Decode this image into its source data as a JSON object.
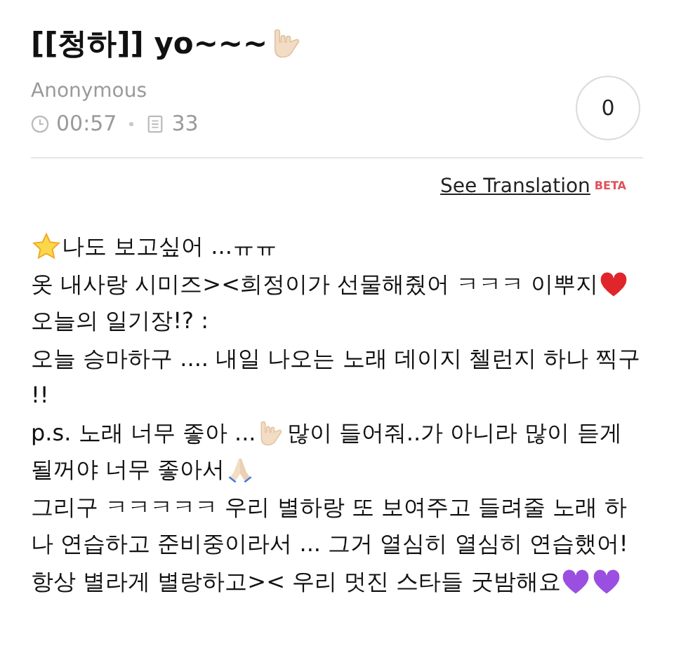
{
  "post": {
    "title": [
      {
        "kind": "text",
        "text": "[[청하]] yo~~~"
      },
      {
        "kind": "rock-hand"
      }
    ],
    "author": "Anonymous",
    "time": "00:57",
    "views": "33",
    "like_count": "0"
  },
  "translation": {
    "link": "See Translation",
    "badge": "BETA"
  },
  "body_lines": [
    [
      {
        "kind": "star"
      },
      {
        "kind": "text",
        "text": " 나도 보고싶어 ...ㅠㅠ"
      }
    ],
    [
      {
        "kind": "text",
        "text": "옷 내사랑 시미즈><희정이가 선물해줬어 ㅋㅋㅋ 이뿌지"
      },
      {
        "kind": "heart"
      }
    ],
    [
      {
        "kind": "text",
        "text": "오늘의 일기장!? :"
      }
    ],
    [
      {
        "kind": "text",
        "text": "오늘 승마하구 .... 내일 나오는 노래 데이지 첼런지 하나 찍구"
      }
    ],
    [
      {
        "kind": "text",
        "text": "!!"
      }
    ],
    [
      {
        "kind": "text",
        "text": "p.s. 노래 너무 좋아 ... "
      },
      {
        "kind": "rock-hand"
      },
      {
        "kind": "text",
        "text": "많이 들어줘..가 아니라 많이 듣게"
      }
    ],
    [
      {
        "kind": "text",
        "text": "될꺼야 너무 좋아서"
      },
      {
        "kind": "pray"
      }
    ],
    [
      {
        "kind": "text",
        "text": "그리구 ㅋㅋㅋㅋㅋ 우리 별하랑 또 보여주고 들려줄 노래 하"
      }
    ],
    [
      {
        "kind": "text",
        "text": "나 연습하고 준비중이라서 ... 그거 열심히 열심히 연습했어!"
      }
    ],
    [
      {
        "kind": "text",
        "text": "항상 별라게 별랑하고>< 우리 멋진 스타들 굿밤해요"
      },
      {
        "kind": "purple-heart"
      },
      {
        "kind": "purple-heart"
      }
    ]
  ]
}
